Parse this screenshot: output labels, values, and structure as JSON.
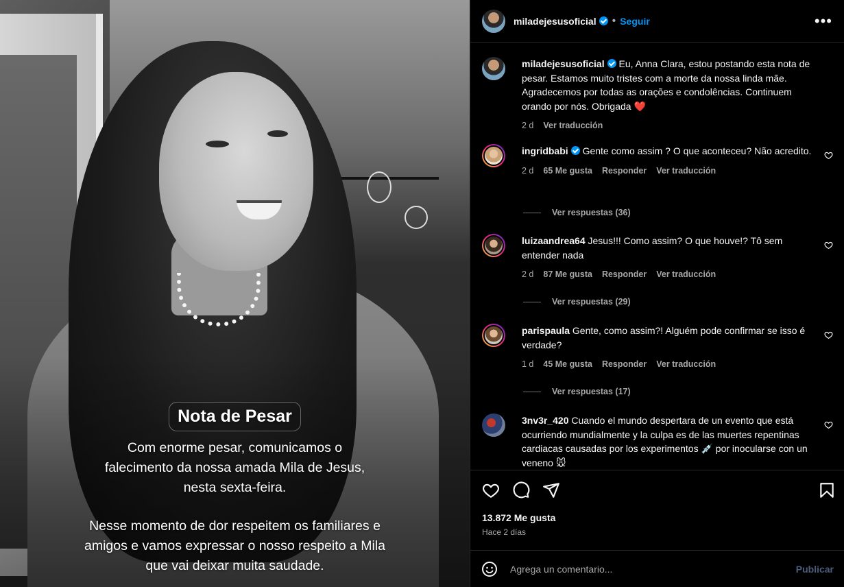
{
  "colors": {
    "background": "#000000",
    "accent": "#0095f6",
    "muted": "#a8a8a8",
    "heart": "#ff3040",
    "divider": "#262626"
  },
  "media": {
    "title": "Nota de Pesar",
    "paragraph1": "Com enorme pesar, comunicamos o falecimento da nossa amada Mila de Jesus, nesta sexta-feira.",
    "paragraph2": "Nesse momento de dor respeitem os  familiares e amigos e vamos expressar o nosso respeito a Mila que vai deixar muita saudade."
  },
  "header": {
    "username": "miladejesusoficial",
    "separator": "•",
    "follow_label": "Seguir",
    "more_icon": "more-horizontal-icon"
  },
  "caption": {
    "username": "miladejesusoficial",
    "text": "Eu, Anna Clara, estou postando esta nota de pesar. Estamos muito tristes com a morte da nossa linda mãe. Agradecemos por todas as orações e condolências. Continuem orando por nós. Obrigada",
    "emoji": "❤️",
    "time": "2 d",
    "translate": "Ver traducción"
  },
  "comments": [
    {
      "username": "ingridbabi",
      "verified": true,
      "text": "Gente como assim ? O que aconteceu? Não acredito.",
      "time": "2 d",
      "likes": "65 Me gusta",
      "reply": "Responder",
      "translate": "Ver traducción",
      "replies": "Ver respuestas (36)"
    },
    {
      "username": "luizaandrea64",
      "verified": false,
      "text": "Jesus!!! Como assim? O que houve!? Tô sem entender nada",
      "time": "2 d",
      "likes": "87 Me gusta",
      "reply": "Responder",
      "translate": "Ver traducción",
      "replies": "Ver respuestas (29)"
    },
    {
      "username": "parispaula",
      "verified": false,
      "text": "Gente, como assim?! Alguém pode confirmar se isso é verdade?",
      "time": "1 d",
      "likes": "45 Me gusta",
      "reply": "Responder",
      "translate": "Ver traducción",
      "replies": "Ver respuestas (17)"
    },
    {
      "username": "3nv3r_420",
      "verified": false,
      "text": "Cuando el mundo despertara de un evento que está ocurriendo mundialmente y la culpa es de las muertes repentinas cardiacas causadas por los experimentos 💉 por inocularse con un veneno 🐭"
    }
  ],
  "actions": {
    "likes": "13.872 Me gusta",
    "time_ago": "Hace 2 días"
  },
  "add_comment": {
    "placeholder": "Agrega un comentario...",
    "publish_label": "Publicar"
  }
}
